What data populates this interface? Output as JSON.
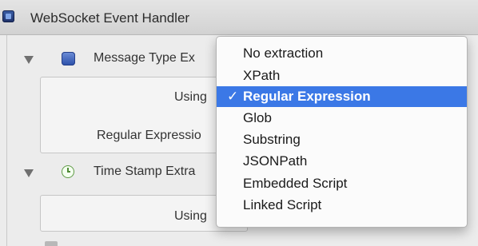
{
  "window": {
    "title": "WebSocket Event Handler",
    "icon": "websocket-app-icon"
  },
  "tree": {
    "message_type": {
      "label": "Message Type Ex",
      "icon": "message-type-icon",
      "using_label": "Using",
      "regex_label": "Regular Expressio"
    },
    "time_stamp": {
      "label": "Time Stamp Extra",
      "icon": "clock-icon",
      "using_label": "Using"
    }
  },
  "menu": {
    "check_glyph": "✓",
    "selected": "Regular Expression",
    "items": [
      "No extraction",
      "XPath",
      "Regular Expression",
      "Glob",
      "Substring",
      "JSONPath",
      "Embedded Script",
      "Linked Script"
    ]
  },
  "colors": {
    "selection": "#3b78e6",
    "titlebar": "#d8d8d8"
  }
}
